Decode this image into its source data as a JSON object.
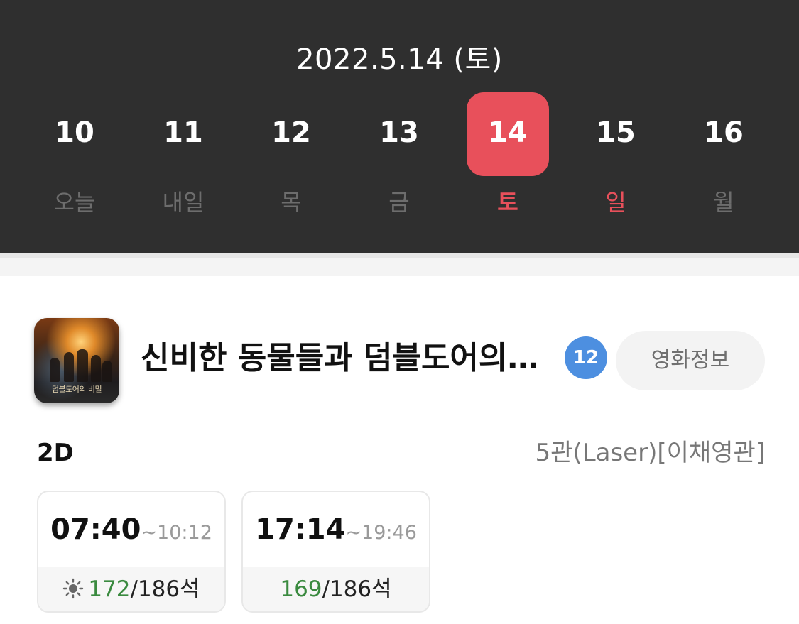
{
  "header": {
    "date_title": "2022.5.14 (토)",
    "days": [
      {
        "num": "10",
        "label": "오늘",
        "selected": false
      },
      {
        "num": "11",
        "label": "내일",
        "selected": false
      },
      {
        "num": "12",
        "label": "목",
        "selected": false
      },
      {
        "num": "13",
        "label": "금",
        "selected": false
      },
      {
        "num": "14",
        "label": "토",
        "selected": true
      },
      {
        "num": "15",
        "label": "일",
        "selected": false
      },
      {
        "num": "16",
        "label": "월",
        "selected": false
      }
    ],
    "colors": {
      "background": "#2f2f2f",
      "selected": "#e8505b",
      "weekend": "#e8505b"
    }
  },
  "movie": {
    "title": "신비한 동물들과 덤블도어의 비밀",
    "poster_caption": "덤블도어의 비밀",
    "age_rating": "12",
    "info_button": "영화정보"
  },
  "screening": {
    "format": "2D",
    "hall": "5관(Laser)[이채영관]",
    "showtimes": [
      {
        "start": "07:40",
        "end": "~10:12",
        "available": "172",
        "total": "/186석",
        "morning_icon": "sun-icon"
      },
      {
        "start": "17:14",
        "end": "~19:46",
        "available": "169",
        "total": "/186석",
        "morning_icon": ""
      }
    ]
  }
}
